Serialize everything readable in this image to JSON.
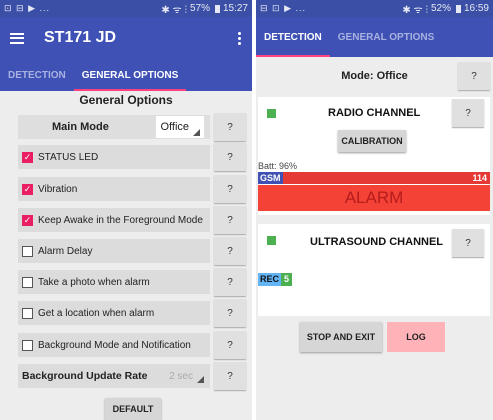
{
  "left": {
    "status": {
      "icons": "⊡ ⊟ ▶ ...",
      "signal": "✱ ᯤ ⫶",
      "battery": "57%",
      "time": "15:27"
    },
    "app_title": "ST171 JD",
    "tabs": [
      {
        "label": "DETECTION"
      },
      {
        "label": "GENERAL OPTIONS"
      }
    ],
    "section_title": "General Options",
    "main_mode": {
      "label": "Main Mode",
      "value": "Office"
    },
    "options": [
      {
        "label": "STATUS LED",
        "checked": true
      },
      {
        "label": "Vibration",
        "checked": true
      },
      {
        "label": "Keep Awake in the Foreground Mode",
        "checked": true
      },
      {
        "label": "Alarm Delay",
        "checked": false
      },
      {
        "label": "Take a photo when alarm",
        "checked": false
      },
      {
        "label": "Get a location when alarm",
        "checked": false
      },
      {
        "label": "Background Mode and Notification",
        "checked": false
      }
    ],
    "bg_rate": {
      "label": "Background Update Rate",
      "value": "2 sec"
    },
    "help_label": "?",
    "default_button": "DEFAULT"
  },
  "right": {
    "status": {
      "icons": "⊟ ⊡ ▶ ...",
      "signal": "✱ ᯤ ⫶",
      "battery": "52%",
      "time": "16:59"
    },
    "tabs": [
      {
        "label": "DETECTION"
      },
      {
        "label": "GENERAL OPTIONS"
      }
    ],
    "mode_label": "Mode: Office",
    "help_label": "?",
    "radio": {
      "title": "RADIO CHANNEL",
      "calibration": "CALIBRATION",
      "battery": "Batt: 96%",
      "gsm_label": "GSM",
      "gsm_value": "114",
      "alarm": "ALARM"
    },
    "ultrasound": {
      "title": "ULTRASOUND CHANNEL",
      "rec_label": "REC",
      "rec_value": "5"
    },
    "stop_button": "STOP AND EXIT",
    "log_button": "LOG"
  },
  "colors": {
    "primary": "#3f51b5",
    "accent": "#ff4081",
    "checkbox": "#e91e63",
    "alarm": "#f44336",
    "gsm_bar": "#e53935",
    "green": "#4caf50",
    "rec_bar": "#64b5f6"
  }
}
